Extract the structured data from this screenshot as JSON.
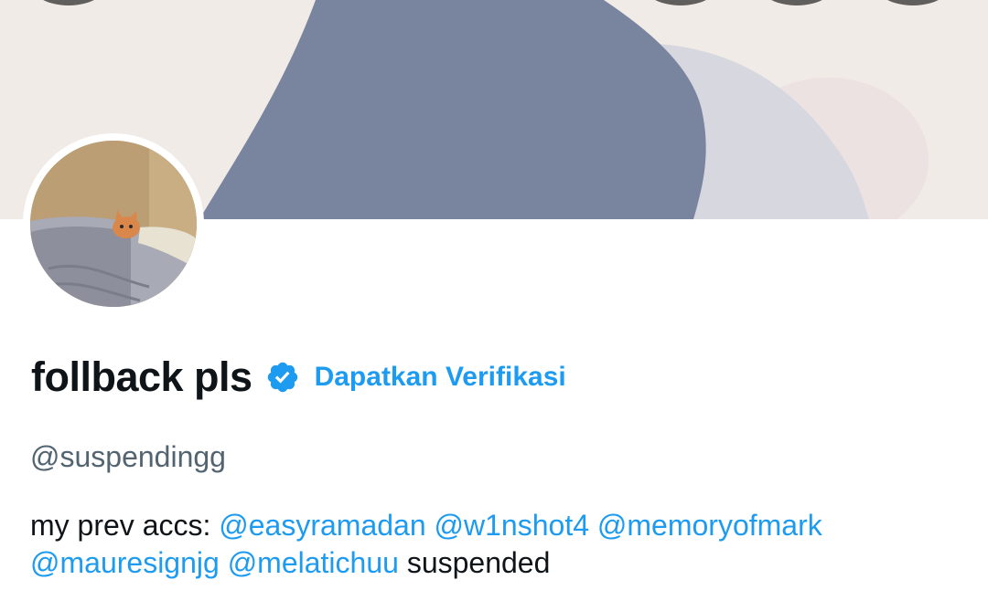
{
  "profile": {
    "display_name": "follback pls",
    "verified_badge_icon": "verified-badge-icon",
    "get_verified_label": "Dapatkan Verifikasi",
    "handle": "@suspendingg",
    "bio": {
      "prefix": "my prev accs:",
      "mentions": [
        "@easyramadan",
        "@w1nshot4",
        "@memoryofmark",
        "@mauresignjg",
        "@melatichuu"
      ],
      "suffix": "suspended"
    }
  },
  "colors": {
    "accent": "#1d9bf0",
    "text_primary": "#0f1419",
    "text_secondary": "#536471"
  }
}
